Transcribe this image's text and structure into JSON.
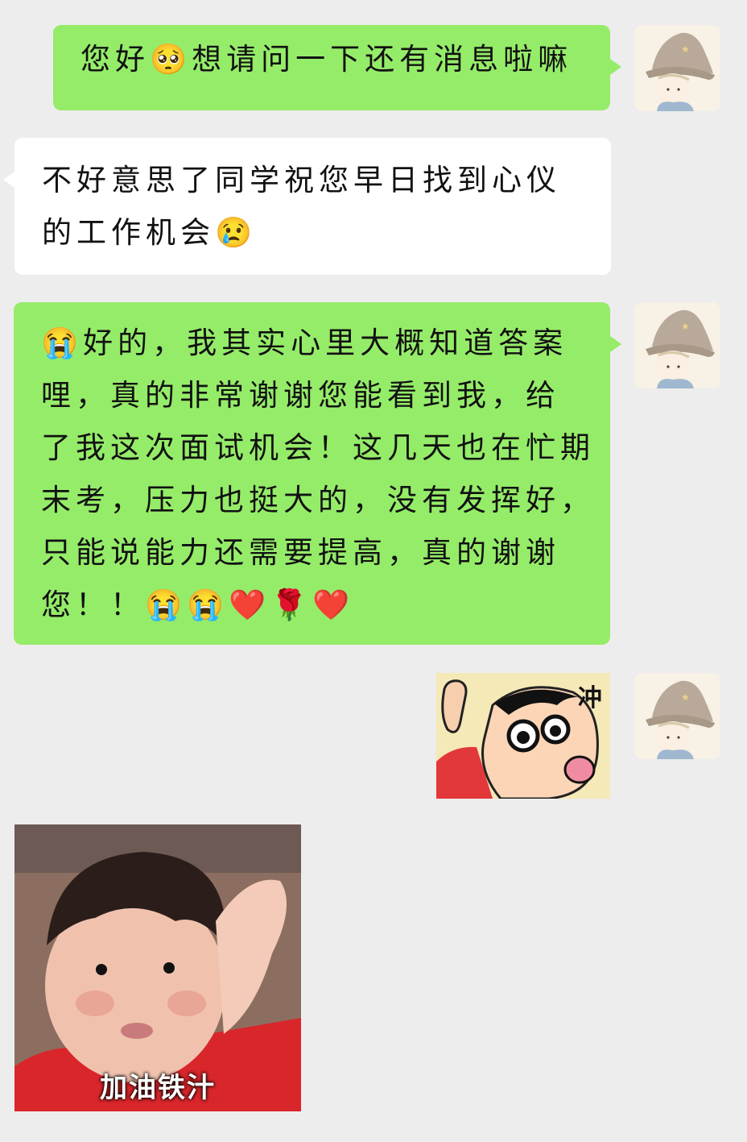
{
  "messages": [
    {
      "sender": "me",
      "lines": [
        "您好🥺想请问一下还有消息啦嘛"
      ]
    },
    {
      "sender": "other",
      "lines": [
        "不好意思了同学祝您早日找到心仪",
        "的工作机会😢"
      ]
    },
    {
      "sender": "me",
      "lines": [
        "😭好的，我其实心里大概知道答案",
        "哩，真的非常谢谢您能看到我，给",
        "了我这次面试机会！这几天也在忙期",
        "末考，压力也挺大的，没有发挥好，",
        "只能说能力还需要提高，真的谢谢",
        "您！！😭😭❤️🌹❤️"
      ]
    },
    {
      "sender": "me",
      "sticker_text": "冲"
    },
    {
      "sender": "other",
      "sticker_text": "加油铁汁"
    }
  ]
}
